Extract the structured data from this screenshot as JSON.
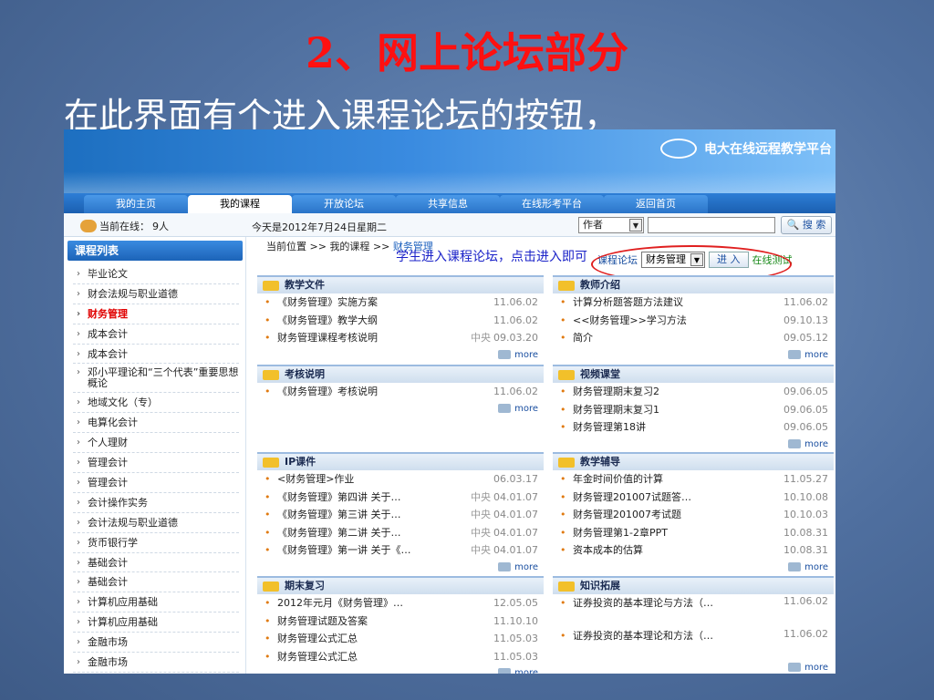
{
  "slide": {
    "title": "2、网上论坛部分",
    "subtitle": "在此界面有个进入课程论坛的按钮，"
  },
  "banner": {
    "logo_text": "电大在线远程教学平台"
  },
  "nav": {
    "tabs": [
      "我的主页",
      "我的课程",
      "开放论坛",
      "共享信息",
      "在线形考平台",
      "返回首页"
    ]
  },
  "infobar": {
    "online_label": "当前在线：",
    "online_count": "9人",
    "date": "今天是2012年7月24日星期二",
    "author_select": "作者",
    "search_input": "",
    "search_label": "搜 索"
  },
  "sidebar": {
    "title": "课程列表",
    "items": [
      "毕业论文",
      "财会法规与职业道德",
      "财务管理",
      "成本会计",
      "成本会计",
      "邓小平理论和“三个代表”重要思想概论",
      "地域文化（专）",
      "电算化会计",
      "个人理财",
      "管理会计",
      "管理会计",
      "会计操作实务",
      "会计法规与职业道德",
      "货币银行学",
      "基础会计",
      "基础会计",
      "计算机应用基础",
      "计算机应用基础",
      "金融市场",
      "金融市场"
    ]
  },
  "breadcrumb": {
    "prefix": "当前位置",
    "sep": ">>",
    "mid": "我的课程",
    "current": "财务管理"
  },
  "annotation": "学生进入课程论坛，点击进入即可",
  "forum": {
    "label": "课程论坛",
    "select": "财务管理",
    "enter_label": "进 入",
    "extra": "在线测试"
  },
  "more_label": "more",
  "panels": [
    {
      "title": "教学文件",
      "items": [
        {
          "text": "《财务管理》实施方案",
          "src": "",
          "date": "11.06.02"
        },
        {
          "text": "《财务管理》教学大纲",
          "src": "",
          "date": "11.06.02"
        },
        {
          "text": "财务管理课程考核说明",
          "src": "中央",
          "date": "09.03.20"
        }
      ]
    },
    {
      "title": "教师介绍",
      "items": [
        {
          "text": "计算分析题答题方法建议",
          "src": "",
          "date": "11.06.02"
        },
        {
          "text": "<<财务管理>>学习方法",
          "src": "",
          "date": "09.10.13"
        },
        {
          "text": "简介",
          "src": "",
          "date": "09.05.12"
        }
      ]
    },
    {
      "title": "考核说明",
      "items": [
        {
          "text": "《财务管理》考核说明",
          "src": "",
          "date": "11.06.02"
        }
      ]
    },
    {
      "title": "视频课堂",
      "items": [
        {
          "text": "财务管理期末复习2",
          "src": "",
          "date": "09.06.05"
        },
        {
          "text": "财务管理期末复习1",
          "src": "",
          "date": "09.06.05"
        },
        {
          "text": "财务管理第18讲",
          "src": "",
          "date": "09.06.05"
        }
      ]
    },
    {
      "title": "IP课件",
      "items": [
        {
          "text": "<财务管理>作业",
          "src": "",
          "date": "06.03.17"
        },
        {
          "text": "《财务管理》第四讲 关于…",
          "src": "中央",
          "date": "04.01.07"
        },
        {
          "text": "《财务管理》第三讲 关于…",
          "src": "中央",
          "date": "04.01.07"
        },
        {
          "text": "《财务管理》第二讲 关于…",
          "src": "中央",
          "date": "04.01.07"
        },
        {
          "text": "《财务管理》第一讲 关于《…",
          "src": "中央",
          "date": "04.01.07"
        }
      ]
    },
    {
      "title": "教学辅导",
      "items": [
        {
          "text": "年金时间价值的计算",
          "src": "",
          "date": "11.05.27"
        },
        {
          "text": "财务管理201007试题答…",
          "src": "",
          "date": "10.10.08"
        },
        {
          "text": "财务管理201007考试题",
          "src": "",
          "date": "10.10.03"
        },
        {
          "text": "财务管理第1-2章PPT",
          "src": "",
          "date": "10.08.31"
        },
        {
          "text": "资本成本的估算",
          "src": "",
          "date": "10.08.31"
        }
      ]
    },
    {
      "title": "期末复习",
      "items": [
        {
          "text": "2012年元月《财务管理》…",
          "src": "",
          "date": "12.05.05"
        },
        {
          "text": "财务管理试题及答案",
          "src": "",
          "date": "11.10.10"
        },
        {
          "text": "财务管理公式汇总",
          "src": "",
          "date": "11.05.03"
        },
        {
          "text": "财务管理公式汇总",
          "src": "",
          "date": "11.05.03"
        }
      ]
    },
    {
      "title": "知识拓展",
      "items": [
        {
          "text": "证券投资的基本理论与方法（…",
          "src": "",
          "date": "11.06.02"
        },
        {
          "text": "证券投资的基本理论和方法（…",
          "src": "",
          "date": "11.06.02"
        }
      ]
    }
  ]
}
